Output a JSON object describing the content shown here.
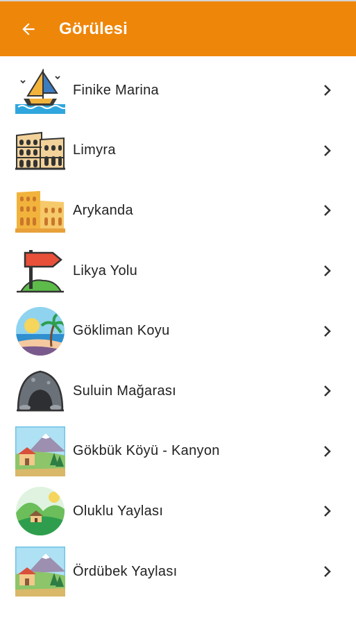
{
  "header": {
    "title": "Görülesi",
    "back_icon": "arrow-left-icon",
    "color": "#EE860A"
  },
  "items": [
    {
      "label": "Finike Marina",
      "icon": "sailboat-icon"
    },
    {
      "label": "Limyra",
      "icon": "colosseum-icon"
    },
    {
      "label": "Arykanda",
      "icon": "ancient-ruins-icon"
    },
    {
      "label": "Likya Yolu",
      "icon": "signpost-icon"
    },
    {
      "label": "Gökliman Koyu",
      "icon": "beach-palm-icon"
    },
    {
      "label": "Suluin Mağarası",
      "icon": "cave-icon"
    },
    {
      "label": "Gökbük Köyü - Kanyon",
      "icon": "village-mountain-icon"
    },
    {
      "label": "Oluklu Yaylası",
      "icon": "hill-cabin-icon"
    },
    {
      "label": "Ördübek Yaylası",
      "icon": "village-mountain-icon"
    }
  ]
}
